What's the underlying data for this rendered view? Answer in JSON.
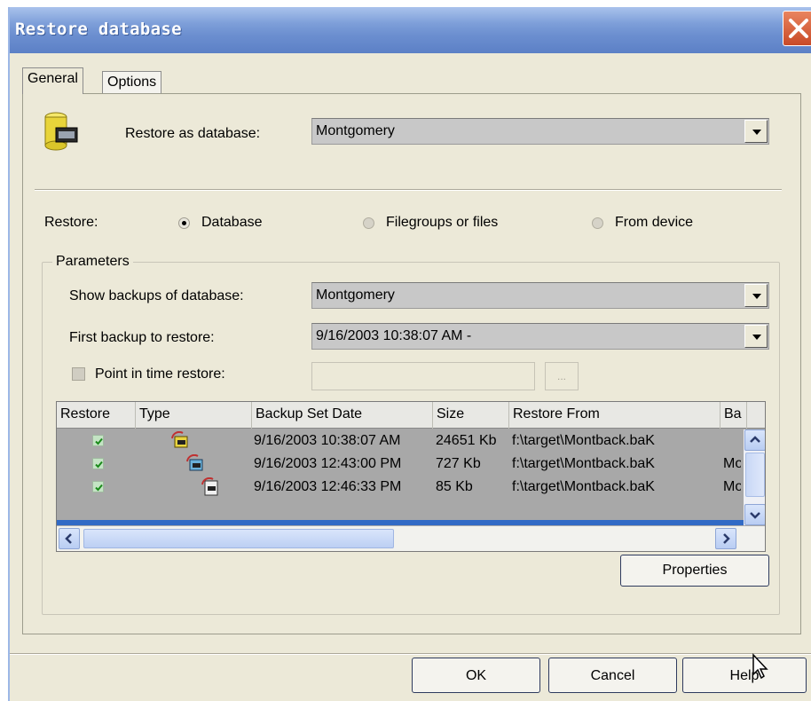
{
  "window": {
    "title": "Restore database",
    "close_icon": "close-icon"
  },
  "tabs": [
    {
      "label": "General",
      "active": true
    },
    {
      "label": "Options",
      "active": false
    }
  ],
  "restore_as": {
    "label": "Restore as database:",
    "value": "Montgomery"
  },
  "restore": {
    "label": "Restore:",
    "options": [
      {
        "label": "Database",
        "selected": true
      },
      {
        "label": "Filegroups or files",
        "selected": false
      },
      {
        "label": "From device",
        "selected": false
      }
    ]
  },
  "parameters": {
    "legend": "Parameters",
    "show_backups": {
      "label": "Show backups of database:",
      "value": "Montgomery"
    },
    "first_backup": {
      "label": "First backup to restore:",
      "value": "9/16/2003 10:38:07 AM -"
    },
    "point_in_time": {
      "label": "Point in time restore:",
      "checked": false,
      "value": "",
      "browse_label": "..."
    }
  },
  "backups_table": {
    "columns": [
      "Restore",
      "Type",
      "Backup Set Date",
      "Size",
      "Restore From",
      "Ba"
    ],
    "rows": [
      {
        "restore": true,
        "type_icon": "full-backup-icon",
        "date": "9/16/2003 10:38:07 AM",
        "size": "24651 Kb",
        "from": "f:\\target\\Montback.baK",
        "ba": ""
      },
      {
        "restore": true,
        "type_icon": "differential-backup-icon",
        "date": "9/16/2003 12:43:00 PM",
        "size": "727 Kb",
        "from": "f:\\target\\Montback.baK",
        "ba": "Mo"
      },
      {
        "restore": true,
        "type_icon": "log-backup-icon",
        "date": "9/16/2003 12:46:33 PM",
        "size": "85 Kb",
        "from": "f:\\target\\Montback.baK",
        "ba": "Mo"
      }
    ]
  },
  "properties_button": "Properties",
  "footer": {
    "ok": "OK",
    "cancel": "Cancel",
    "help": "Help"
  },
  "colors": {
    "title_bar": "#7e9fd9",
    "dialog_bg": "#ece9d8",
    "selection": "#316ac5"
  }
}
